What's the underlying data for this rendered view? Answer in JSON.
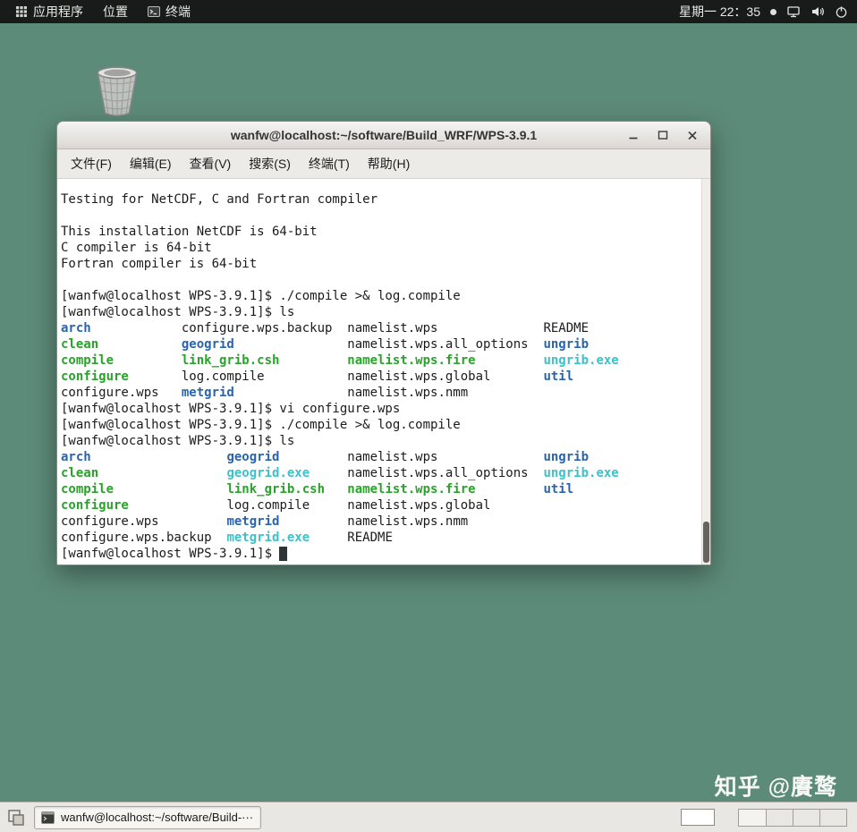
{
  "topbar": {
    "menus": [
      {
        "label": "应用程序"
      },
      {
        "label": "位置"
      },
      {
        "label": "终端"
      }
    ],
    "clock": "星期一 22：35"
  },
  "window": {
    "title": "wanfw@localhost:~/software/Build_WRF/WPS-3.9.1",
    "controls": [
      "minimize",
      "maximize",
      "close"
    ],
    "menu": [
      "文件(F)",
      "编辑(E)",
      "查看(V)",
      "搜索(S)",
      "终端(T)",
      "帮助(H)"
    ]
  },
  "terminal": {
    "lines": [
      [
        {
          "t": "Testing for NetCDF, C and Fortran compiler"
        }
      ],
      [],
      [
        {
          "t": "This installation NetCDF is 64-bit"
        }
      ],
      [
        {
          "t": "C compiler is 64-bit"
        }
      ],
      [
        {
          "t": "Fortran compiler is 64-bit"
        }
      ],
      [],
      [
        {
          "t": "[wanfw@localhost WPS-3.9.1]$ ./compile >& log.compile"
        }
      ],
      [
        {
          "t": "[wanfw@localhost WPS-3.9.1]$ ls"
        }
      ],
      [
        {
          "t": "arch            ",
          "c": "dir"
        },
        {
          "t": "configure.wps.backup  namelist.wps              README"
        }
      ],
      [
        {
          "t": "clean           ",
          "c": "exec"
        },
        {
          "t": "geogrid",
          "c": "dir"
        },
        {
          "t": "               namelist.wps.all_options  "
        },
        {
          "t": "ungrib",
          "c": "dir"
        }
      ],
      [
        {
          "t": "compile         ",
          "c": "exec"
        },
        {
          "t": "link_grib.csh         ",
          "c": "exec"
        },
        {
          "t": "namelist.wps.fire         ",
          "c": "exec"
        },
        {
          "t": "ungrib.exe",
          "c": "link"
        }
      ],
      [
        {
          "t": "configure       ",
          "c": "exec"
        },
        {
          "t": "log.compile           namelist.wps.global       "
        },
        {
          "t": "util",
          "c": "dir"
        }
      ],
      [
        {
          "t": "configure.wps   "
        },
        {
          "t": "metgrid",
          "c": "dir"
        },
        {
          "t": "               namelist.wps.nmm"
        }
      ],
      [
        {
          "t": "[wanfw@localhost WPS-3.9.1]$ vi configure.wps"
        }
      ],
      [
        {
          "t": "[wanfw@localhost WPS-3.9.1]$ ./compile >& log.compile"
        }
      ],
      [
        {
          "t": "[wanfw@localhost WPS-3.9.1]$ ls"
        }
      ],
      [
        {
          "t": "arch                  ",
          "c": "dir"
        },
        {
          "t": "geogrid         ",
          "c": "dir"
        },
        {
          "t": "namelist.wps              "
        },
        {
          "t": "ungrib",
          "c": "dir"
        }
      ],
      [
        {
          "t": "clean                 ",
          "c": "exec"
        },
        {
          "t": "geogrid.exe     ",
          "c": "link"
        },
        {
          "t": "namelist.wps.all_options  "
        },
        {
          "t": "ungrib.exe",
          "c": "link"
        }
      ],
      [
        {
          "t": "compile               ",
          "c": "exec"
        },
        {
          "t": "link_grib.csh   ",
          "c": "exec"
        },
        {
          "t": "namelist.wps.fire         ",
          "c": "exec"
        },
        {
          "t": "util",
          "c": "dir"
        }
      ],
      [
        {
          "t": "configure             ",
          "c": "exec"
        },
        {
          "t": "log.compile     namelist.wps.global"
        }
      ],
      [
        {
          "t": "configure.wps         "
        },
        {
          "t": "metgrid",
          "c": "dir"
        },
        {
          "t": "         namelist.wps.nmm"
        }
      ],
      [
        {
          "t": "configure.wps.backup  "
        },
        {
          "t": "metgrid.exe",
          "c": "link"
        },
        {
          "t": "     README"
        }
      ],
      [
        {
          "t": "[wanfw@localhost WPS-3.9.1]$ "
        },
        {
          "t": " ",
          "c": "cursor"
        }
      ]
    ]
  },
  "taskbar": {
    "window_button": "wanfw@localhost:~/software/Build-···",
    "workspace_count": 4,
    "active_workspace": 1
  },
  "watermark": "知乎 @賡鹜",
  "colors": {
    "desktop_bg": "#5d8b7a",
    "directory_blue": "#2a64ad",
    "executable_green": "#29a329",
    "symlink_cyan": "#3ec1c9",
    "terminal_fg": "#1b1b1b",
    "terminal_bg": "#ffffff",
    "panel_bg": "#191b1a"
  }
}
